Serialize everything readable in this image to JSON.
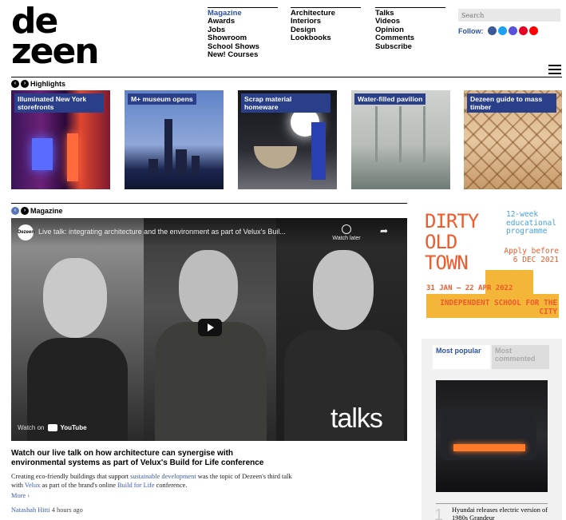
{
  "logo": {
    "line1": "de",
    "line2": "zeen"
  },
  "nav": {
    "col1": [
      "Magazine",
      "Awards",
      "Jobs",
      "Showroom",
      "School Shows",
      "New! Courses"
    ],
    "col2": [
      "Architecture",
      "Interiors",
      "Design",
      "Lookbooks"
    ],
    "col3": [
      "Talks",
      "Videos",
      "Opinion",
      "Comments",
      "Subscribe"
    ]
  },
  "search": {
    "placeholder": "Search"
  },
  "follow": {
    "label": "Follow:",
    "icons": [
      "facebook-icon",
      "twitter-icon",
      "instagram-icon",
      "pinterest-icon",
      "youtube-icon"
    ],
    "colors": [
      "#3b5998",
      "#1da1f2",
      "#5851db",
      "#e60023",
      "#ff0000"
    ]
  },
  "highlights": {
    "title": "Highlights",
    "items": [
      {
        "caption": "Illuminated New York storefronts"
      },
      {
        "caption": "M+ museum opens"
      },
      {
        "caption": "Scrap material homeware"
      },
      {
        "caption": "Water-filled pavilion"
      },
      {
        "caption": "Dezeen guide to mass timber"
      }
    ]
  },
  "magazine": {
    "title": "Magazine",
    "video": {
      "channel_logo": "Dezeen",
      "title": "Live talk: integrating architecture and the environment as part of Velux's Buil...",
      "watch_later": "Watch later",
      "share": "➦",
      "watch_on": "Watch on",
      "youtube": "YouTube",
      "overlay": "talks"
    },
    "headline": "Watch our live talk on how architecture can synergise with environmental systems as part of Velux's Build for Life conference",
    "teaser": {
      "t1": "Creating eco-friendly buildings that support ",
      "link1": "sustainable development",
      "t2": " was the topic of Dezeen's third talk with ",
      "link2": "Velux",
      "t3": " as part of the brand's online ",
      "link3": "Build for Life",
      "t4": " conference."
    },
    "more": "More ›",
    "author": "Natashah Hitti",
    "time": "4 hours ago"
  },
  "ad": {
    "title": "DIRTY OLD TOWN",
    "weeks": "12-week educational programme",
    "apply": "Apply before 6 DEC 2021",
    "dates": "31 JAN – 22 APR 2022",
    "school": "INDEPENDENT SCHOOL FOR THE CITY"
  },
  "most": {
    "tab_popular": "Most popular",
    "tab_commented": "Most commented",
    "rank": "1",
    "item": "Hyundai releases electric version of 1980s Grandeur"
  }
}
